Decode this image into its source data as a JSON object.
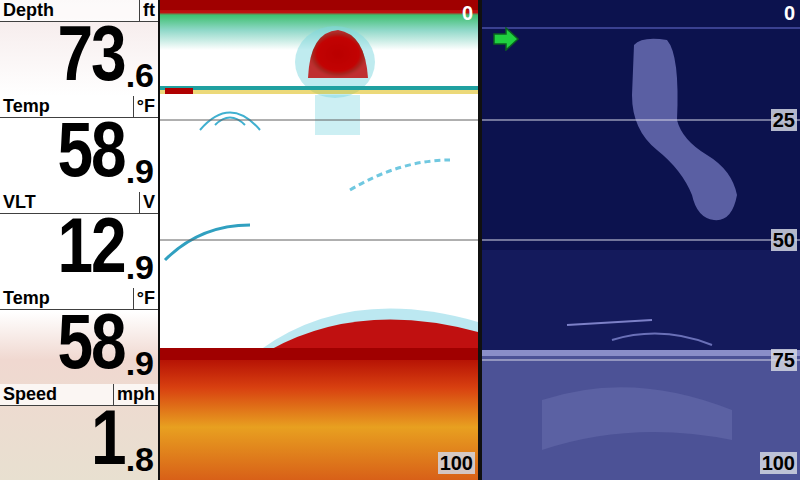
{
  "readouts": [
    {
      "label": "Depth",
      "unit": "ft",
      "whole": "73",
      "fraction": ".6"
    },
    {
      "label": "Temp",
      "unit": "°F",
      "whole": "58",
      "fraction": ".9"
    },
    {
      "label": "VLT",
      "unit": "V",
      "whole": "12",
      "fraction": ".9"
    },
    {
      "label": "Temp",
      "unit": "°F",
      "whole": "58",
      "fraction": ".9"
    },
    {
      "label": "Speed",
      "unit": "mph",
      "whole": "1",
      "fraction": ".8"
    }
  ],
  "sonar": {
    "scale_top": "0",
    "scale_bottom": "100"
  },
  "down_imaging": {
    "scale": [
      "0",
      "25",
      "50",
      "75",
      "100"
    ]
  }
}
